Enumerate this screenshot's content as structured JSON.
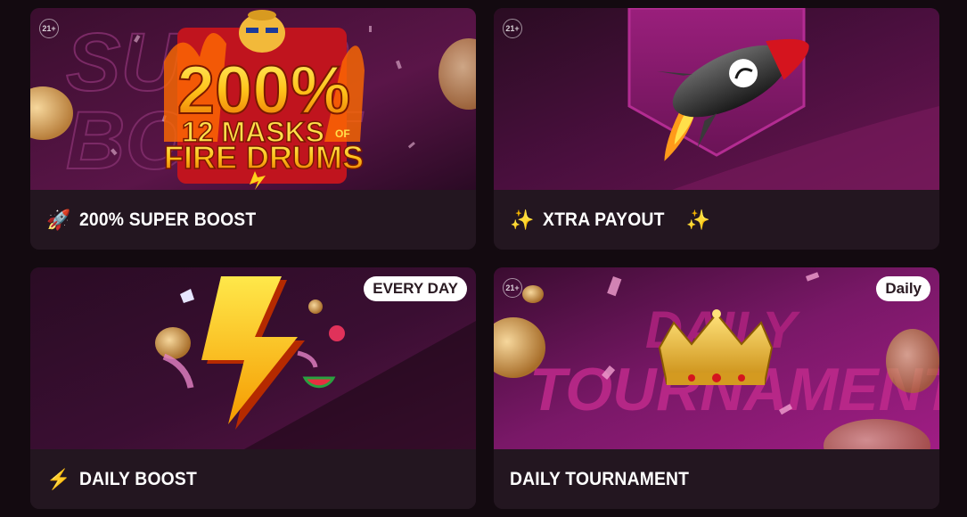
{
  "cards": [
    {
      "title": "200% SUPER BOOST",
      "emoji": "🚀",
      "age_badge": "21+",
      "banner": {
        "headline": "200%",
        "game_line1": "12 MASKS",
        "game_of": "OF",
        "game_line2": "FIRE DRUMS",
        "bg_text1": "SUPER",
        "bg_text2": "BOOST"
      }
    },
    {
      "title": "XTRA PAYOUT",
      "emoji": "✨",
      "emoji_after": "✨",
      "age_badge": "21+"
    },
    {
      "title": "DAILY BOOST",
      "emoji": "⚡",
      "badge": "EVERY DAY"
    },
    {
      "title": "DAILY TOURNAMENT",
      "age_badge": "21+",
      "badge": "Daily",
      "banner": {
        "bg_text1": "DAILY",
        "bg_text2": "TOURNAMENT"
      }
    }
  ],
  "colors": {
    "page_bg": "#130a10",
    "card_footer": "#231620",
    "accent_magenta": "#8a1a6a",
    "badge_bg": "#ffffff"
  }
}
